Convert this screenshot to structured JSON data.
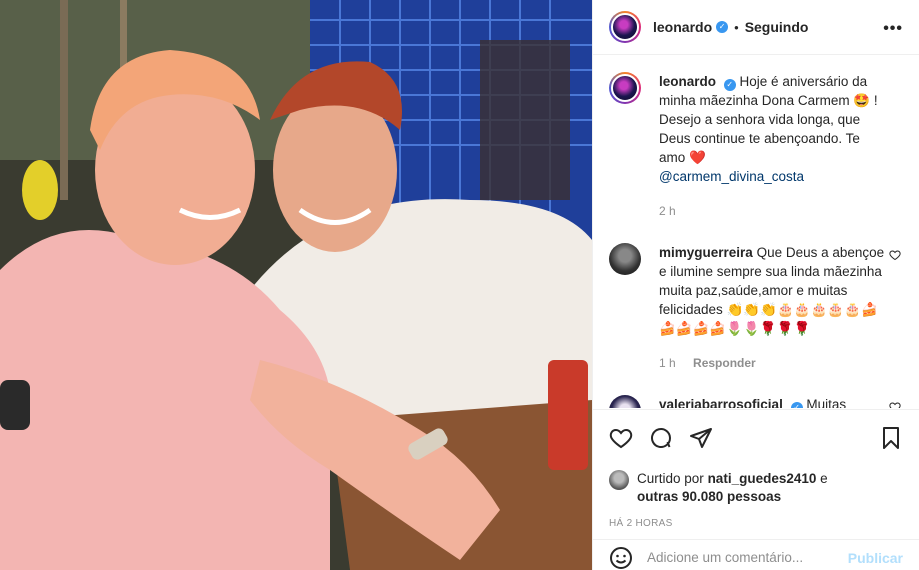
{
  "post": {
    "author": "leonardo",
    "follow_state": "Seguindo",
    "caption_text": "Hoje é aniversário da minha mãezinha Dona Carmem 🤩 ! Desejo a senhora vida longa, que Deus continue te abençoando. Te amo",
    "caption_heart": "❤️",
    "caption_mention": "@carmem_divina_costa",
    "caption_time": "2 h"
  },
  "comments": [
    {
      "user": "mimyguerreira",
      "text": "Que Deus a abençoe e ilumine sempre sua linda mãezinha muita paz,saúde,amor e muitas felicidades 👏👏👏🎂🎂🎂🎂🎂🍰🍰🍰🍰🍰🌷🌷🌹🌹🌹",
      "time": "1 h",
      "reply_label": "Responder"
    },
    {
      "user": "valeriabarrosoficial",
      "text": "Muitas"
    }
  ],
  "likes": {
    "prefix": "Curtido por",
    "user": "nati_guedes2410",
    "and": "e",
    "others": "outras 90.080 pessoas"
  },
  "posted_ago": "HÁ 2 HORAS",
  "comment_box": {
    "placeholder": "Adicione um comentário...",
    "submit": "Publicar"
  },
  "icons": {
    "more": "more-icon",
    "like": "heart-icon",
    "comment": "comment-icon",
    "share": "share-icon",
    "save": "bookmark-icon",
    "emoji": "emoji-icon"
  },
  "colors": {
    "verified": "#3897f0",
    "mention": "#00376b",
    "submit_disabled": "#b2dffc",
    "secondary_text": "#8e8e8e"
  }
}
